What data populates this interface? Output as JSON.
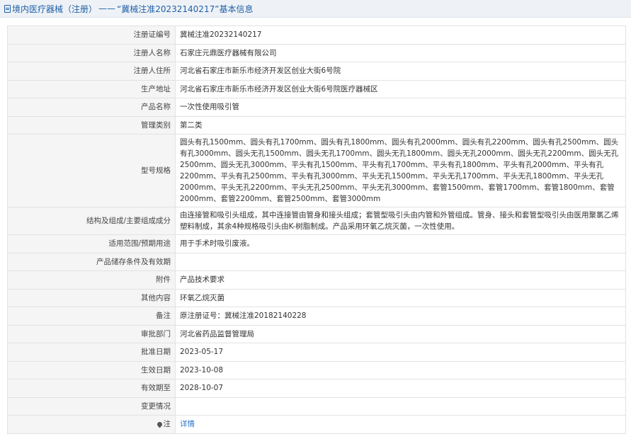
{
  "header": {
    "breadcrumb": "境内医疗器械（注册）",
    "separator": "——",
    "record_title": "“冀械注准20232140217”",
    "suffix": "基本信息"
  },
  "rows": [
    {
      "label": "注册证编号",
      "value": "冀械注准20232140217"
    },
    {
      "label": "注册人名称",
      "value": "石家庄元鼎医疗器械有限公司"
    },
    {
      "label": "注册人住所",
      "value": "河北省石家庄市新乐市经济开发区创业大街6号院"
    },
    {
      "label": "生产地址",
      "value": "河北省石家庄市新乐市经济开发区创业大街6号院医疗器械区"
    },
    {
      "label": "产品名称",
      "value": "一次性使用吸引管"
    },
    {
      "label": "管理类别",
      "value": "第二类"
    },
    {
      "label": "型号规格",
      "value": "圆头有孔1500mm、圆头有孔1700mm、圆头有孔1800mm、圆头有孔2000mm、圆头有孔2200mm、圆头有孔2500mm、圆头有孔3000mm、圆头无孔1500mm、圆头无孔1700mm、圆头无孔1800mm、圆头无孔2000mm、圆头无孔2200mm、圆头无孔2500mm、圆头无孔3000mm、平头有孔1500mm、平头有孔1700mm、平头有孔1800mm、平头有孔2000mm、平头有孔2200mm、平头有孔2500mm、平头有孔3000mm、平头无孔1500mm、平头无孔1700mm、平头无孔1800mm、平头无孔2000mm、平头无孔2200mm、平头无孔2500mm、平头无孔3000mm、套管1500mm、套管1700mm、套管1800mm、套管2000mm、套管2200mm、套管2500mm、套管3000mm"
    },
    {
      "label": "结构及组成/主要组成成分",
      "value": "由连接管和吸引头组成，其中连接管由管身和接头组成；套管型吸引头由内管和外管组成。管身、接头和套管型吸引头由医用聚氯乙烯塑料制成，其余4种规格吸引头由K-树脂制成。产品采用环氧乙烷灭菌，一次性使用。"
    },
    {
      "label": "适用范围/预期用途",
      "value": "用于手术时吸引废液。"
    },
    {
      "label": "产品储存条件及有效期",
      "value": ""
    },
    {
      "label": "附件",
      "value": "产品技术要求"
    },
    {
      "label": "其他内容",
      "value": "环氧乙烷灭菌"
    },
    {
      "label": "备注",
      "value": "原注册证号：冀械注准20182140228"
    },
    {
      "label": "审批部门",
      "value": "河北省药品监督管理局"
    },
    {
      "label": "批准日期",
      "value": "2023-05-17"
    },
    {
      "label": "生效日期",
      "value": "2023-10-08"
    },
    {
      "label": "有效期至",
      "value": "2028-10-07"
    },
    {
      "label": "变更情况",
      "value": ""
    }
  ],
  "note_row": {
    "label": "注",
    "link_text": "详情",
    "icon": "pin-icon"
  },
  "colors": {
    "link": "#2a75c7",
    "header_text": "#1f5fa8",
    "label_bg": "#f5f5f5"
  }
}
